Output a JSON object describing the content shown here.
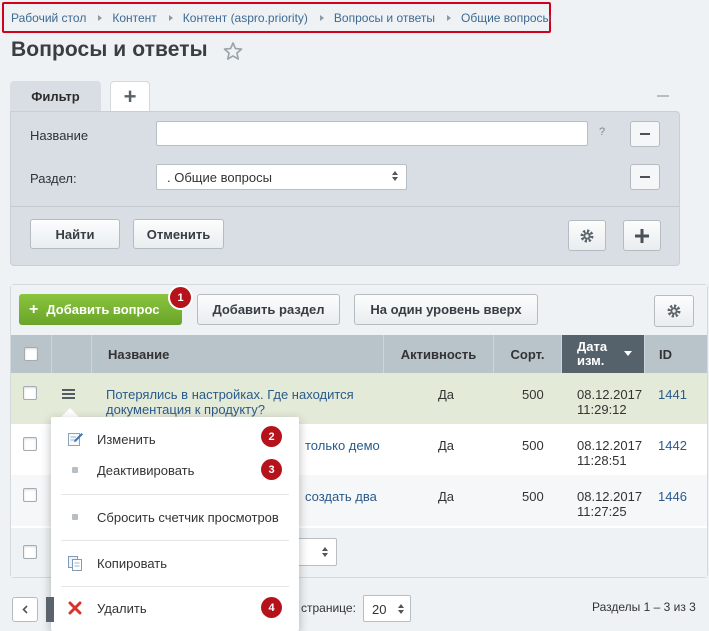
{
  "breadcrumb": [
    "Рабочий стол",
    "Контент",
    "Контент (aspro.priority)",
    "Вопросы и ответы",
    "Общие вопросы"
  ],
  "page_title": "Вопросы и ответы",
  "filter": {
    "tab_label": "Фильтр",
    "tab_add": "+",
    "name_label": "Название",
    "name_value": "",
    "help_mark": "?",
    "section_label": "Раздел:",
    "section_value": ". Общие вопросы",
    "find_button": "Найти",
    "cancel_button": "Отменить"
  },
  "toolbar": {
    "add_question": "Добавить вопрос",
    "add_section": "Добавить раздел",
    "level_up": "На один уровень вверх"
  },
  "columns": {
    "name": "Название",
    "active": "Активность",
    "sort": "Сорт.",
    "date_line1": "Дата",
    "date_line2": "изм.",
    "id": "ID"
  },
  "rows": [
    {
      "name_line1": "Потерялись в настройках. Где находится",
      "name_line2": "документация к продукту?",
      "active": "Да",
      "sort": "500",
      "date": "08.12.2017",
      "time": "11:29:12",
      "id": "1441"
    },
    {
      "name_line1": "только демо",
      "name_line2": "",
      "active": "Да",
      "sort": "500",
      "date": "08.12.2017",
      "time": "11:28:51",
      "id": "1442"
    },
    {
      "name_line1": "создать два",
      "name_line2": "",
      "active": "Да",
      "sort": "500",
      "date": "08.12.2017",
      "time": "11:27:25",
      "id": "1446"
    }
  ],
  "context_menu": {
    "edit": "Изменить",
    "deactivate": "Деактивировать",
    "reset_views": "Сбросить счетчик просмотров",
    "copy": "Копировать",
    "delete": "Удалить"
  },
  "badges": [
    "1",
    "2",
    "3",
    "4"
  ],
  "footer": {
    "per_page_label": "странице:",
    "per_page_value": "20",
    "sections_count": "Разделы 1 – 3 из 3"
  },
  "colors": {
    "accent_green": "#7ab536",
    "badge_red": "#b5121b",
    "link_blue": "#2a5a8c",
    "highlight_border": "#d0021b",
    "selected_row": "#e4ead8"
  }
}
